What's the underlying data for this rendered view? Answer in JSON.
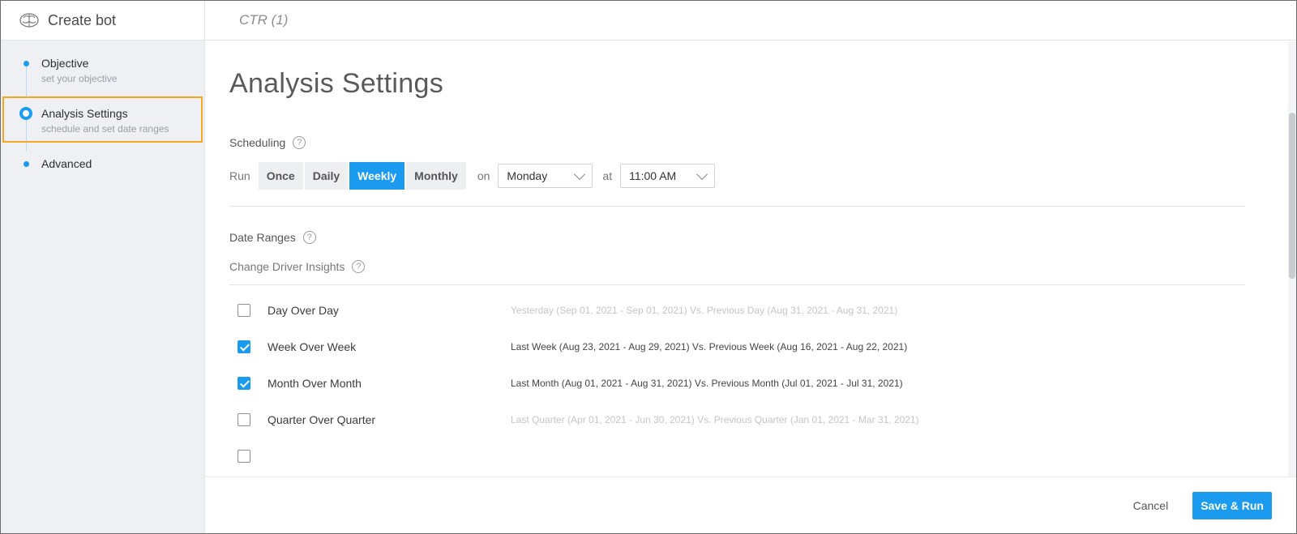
{
  "sidebar": {
    "title": "Create bot",
    "icon": "brain-icon",
    "steps": [
      {
        "title": "Objective",
        "subtitle": "set your objective"
      },
      {
        "title": "Analysis Settings",
        "subtitle": "schedule and set date ranges"
      },
      {
        "title": "Advanced",
        "subtitle": ""
      }
    ]
  },
  "topbar": {
    "title": "CTR (1)"
  },
  "page": {
    "title": "Analysis Settings"
  },
  "scheduling": {
    "label": "Scheduling",
    "run_label": "Run",
    "frequency_options": [
      "Once",
      "Daily",
      "Weekly",
      "Monthly"
    ],
    "selected_frequency": "Weekly",
    "on_label": "on",
    "day_value": "Monday",
    "at_label": "at",
    "time_value": "11:00 AM"
  },
  "date_ranges": {
    "label": "Date Ranges",
    "change_driver_label": "Change Driver Insights",
    "options": [
      {
        "label": "Day Over Day",
        "range": "Yesterday (Sep 01, 2021 - Sep 01, 2021) Vs. Previous Day (Aug 31, 2021 - Aug 31, 2021)",
        "checked": false
      },
      {
        "label": "Week Over Week",
        "range": "Last Week (Aug 23, 2021 - Aug 29, 2021) Vs. Previous Week (Aug 16, 2021 - Aug 22, 2021)",
        "checked": true
      },
      {
        "label": "Month Over Month",
        "range": "Last Month (Aug 01, 2021 - Aug 31, 2021) Vs. Previous Month (Jul 01, 2021 - Jul 31, 2021)",
        "checked": true
      },
      {
        "label": "Quarter Over Quarter",
        "range": "Last Quarter (Apr 01, 2021 - Jun 30, 2021) Vs. Previous Quarter (Jan 01, 2021 - Mar 31, 2021)",
        "checked": false
      }
    ]
  },
  "footer": {
    "cancel_label": "Cancel",
    "save_label": "Save & Run"
  },
  "colors": {
    "accent": "#1a9bf0",
    "highlight": "#f5a623"
  }
}
